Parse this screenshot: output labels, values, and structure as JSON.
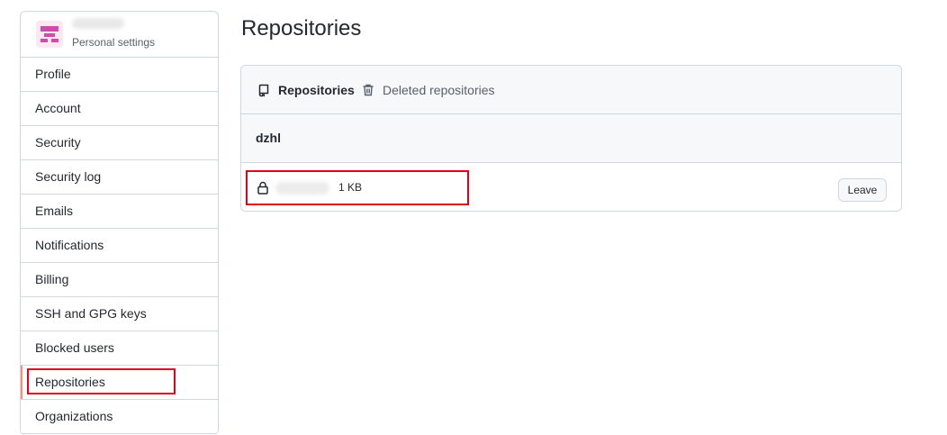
{
  "sidebar": {
    "subtitle": "Personal settings",
    "items": [
      {
        "label": "Profile"
      },
      {
        "label": "Account"
      },
      {
        "label": "Security"
      },
      {
        "label": "Security log"
      },
      {
        "label": "Emails"
      },
      {
        "label": "Notifications"
      },
      {
        "label": "Billing"
      },
      {
        "label": "SSH and GPG keys"
      },
      {
        "label": "Blocked users"
      },
      {
        "label": "Repositories",
        "active": true
      },
      {
        "label": "Organizations"
      }
    ]
  },
  "main": {
    "title": "Repositories",
    "tabs": [
      {
        "label": "Repositories",
        "icon": "repo-icon",
        "selected": true
      },
      {
        "label": "Deleted repositories",
        "icon": "trash-icon"
      }
    ],
    "org": "dzhl",
    "repos": [
      {
        "size": "1 KB",
        "visibility_icon": "lock-icon",
        "action_label": "Leave"
      }
    ]
  },
  "colors": {
    "highlight": "#e0001a",
    "active_accent": "#fd8c73",
    "border": "#d0d7de",
    "header_bg": "#f6f8fa",
    "avatar": "#c84fae"
  }
}
